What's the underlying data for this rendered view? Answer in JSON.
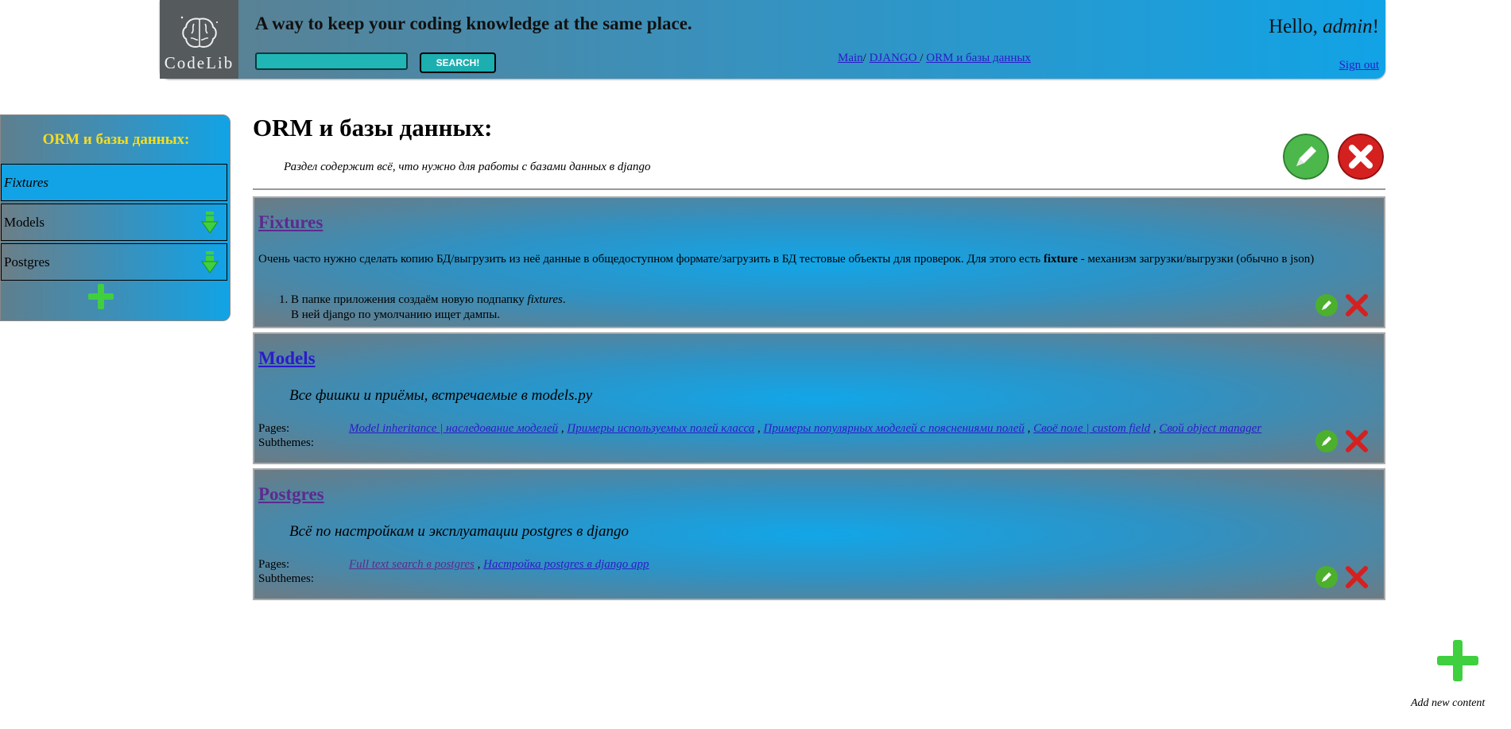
{
  "header": {
    "logo_text": "CodeLib",
    "tagline": "A way to keep your coding knowledge at the same place.",
    "search": {
      "value": "",
      "button_label": "SEARCH!"
    },
    "breadcrumb": [
      {
        "label": "Main"
      },
      {
        "label": "DJANGO "
      },
      {
        "label": "ORM и базы данных"
      }
    ],
    "breadcrumb_sep": "/",
    "greeting_prefix": "Hello, ",
    "username": "admin",
    "greeting_suffix": "!",
    "sign_out": "Sign out"
  },
  "sidebar": {
    "title": "ORM и базы данных:",
    "items": [
      {
        "label": "Fixtures",
        "active": true,
        "has_children": false
      },
      {
        "label": "Models",
        "active": false,
        "has_children": true
      },
      {
        "label": "Postgres",
        "active": false,
        "has_children": true
      }
    ]
  },
  "main": {
    "title": "ORM и базы данных:",
    "description": "Раздел содержит всё, что нужно для работы с базами данных в django",
    "cards": [
      {
        "title": "Fixtures",
        "intro_before": "Очень часто нужно сделать копию БД/выгрузить из неё данные в общедоступном формате/загрузить в БД тестовые объекты для проверок. Для этого есть ",
        "intro_bold": "fixture",
        "intro_after": " - механизм загрузки/выгрузки (обычно в json)",
        "list_item_before": "В папке приложения создаём новую подпапку ",
        "list_item_em": "fixtures",
        "list_item_after": ".",
        "list_item_line2": "В ней django по умолчанию ищет дампы."
      },
      {
        "title": "Models",
        "summary": "Все фишки и приёмы, встречаемые в models.py",
        "pages_label": "Pages:",
        "subthemes_label": "Subthemes:",
        "pages": [
          "Model inheritance | наследование моделей",
          "Примеры используемых полей класса",
          "Примеры популярных моделей с пояснениями полей",
          "Своё поле | custom field",
          "Свой object manager"
        ]
      },
      {
        "title": "Postgres",
        "summary": "Всё по настройкам и эксплуатации postgres в django",
        "pages_label": "Pages:",
        "subthemes_label": "Subthemes:",
        "pages": [
          "Full text search в postgres",
          "Настройка postgres в django app"
        ]
      }
    ],
    "add_new_label": "Add new content"
  },
  "colors": {
    "header_gradient": [
      "#5e7f8e",
      "#11a3e6"
    ],
    "sidebar_title": "#f6dd1e",
    "accent_green": "#3fcf3f",
    "delete_red": "#d52020",
    "link": "#2a1cc8",
    "visited_link": "#5b2b8f"
  },
  "icons": {
    "logo": "brain-icon",
    "edit": "pencil-icon",
    "delete": "close-icon",
    "add": "plus-icon",
    "expand": "down-arrow-icon"
  }
}
